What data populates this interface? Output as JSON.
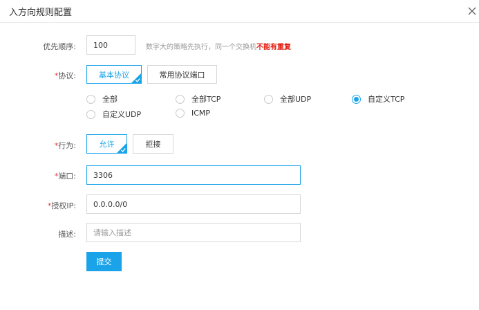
{
  "dialog": {
    "title": "入方向规则配置"
  },
  "priority": {
    "label": "优先顺序:",
    "value": "100",
    "hint_text": "数字大的策略先执行，同一个交换机",
    "hint_warning": "不能有重复"
  },
  "protocol": {
    "required_mark": "*",
    "label": "协议:",
    "tabs": [
      "基本协议",
      "常用协议端口"
    ],
    "selected_tab": "基本协议",
    "options": [
      "全部",
      "全部TCP",
      "全部UDP",
      "自定义TCP",
      "自定义UDP",
      "ICMP"
    ],
    "selected_option": "自定义TCP"
  },
  "action": {
    "required_mark": "*",
    "label": "行为:",
    "options": [
      "允许",
      "拒接"
    ],
    "selected": "允许"
  },
  "port": {
    "required_mark": "*",
    "label": "端口:",
    "value": "3306"
  },
  "auth_ip": {
    "required_mark": "*",
    "label": "授权IP:",
    "value": "0.0.0.0/0"
  },
  "description": {
    "label": "描述:",
    "placeholder": "请输入描述"
  },
  "submit": {
    "label": "提交"
  },
  "colors": {
    "accent": "#1aa3e8",
    "required": "#e4393c",
    "warning": "#e4180b"
  }
}
